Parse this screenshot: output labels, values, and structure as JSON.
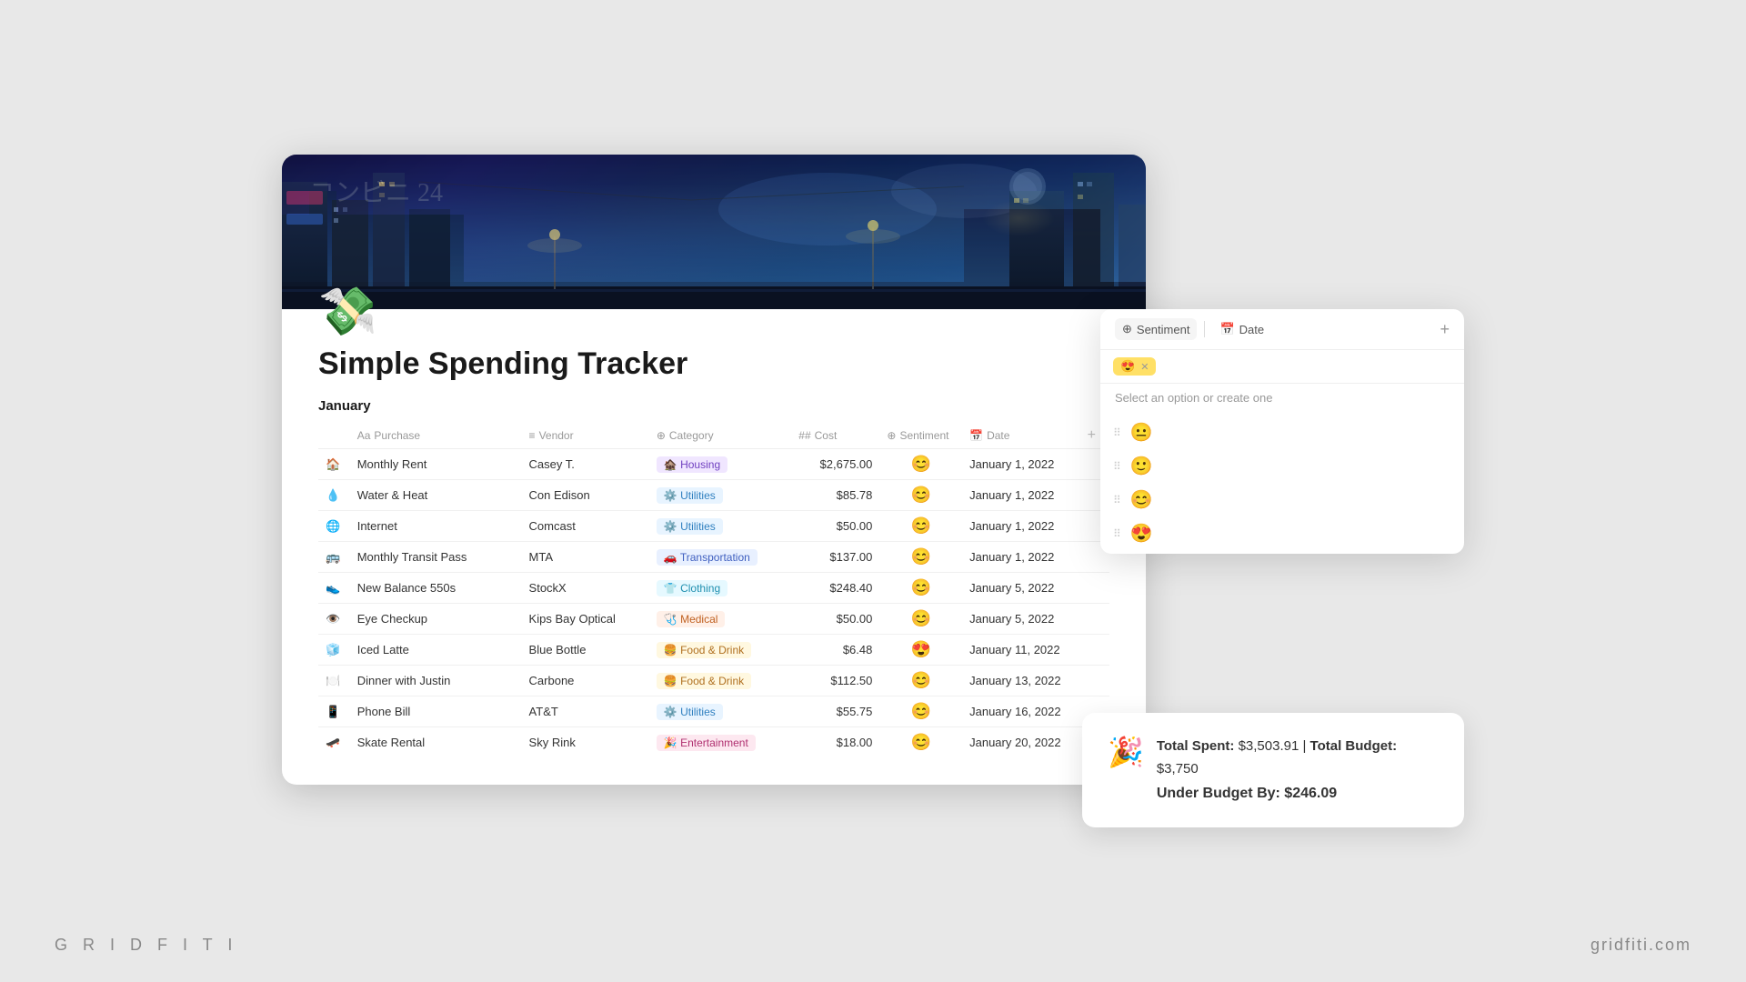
{
  "watermark": {
    "left": "G R I D F I T I",
    "right": "gridfiti.com"
  },
  "page": {
    "title": "Simple Spending Tracker",
    "icon": "💸",
    "section": "January"
  },
  "table": {
    "headers": [
      "Purchase",
      "Vendor",
      "Category",
      "Cost",
      "Sentiment",
      "Date"
    ],
    "rows": [
      {
        "icon": "🏠",
        "purchase": "Monthly Rent",
        "vendor": "Casey T.",
        "category": "Housing",
        "category_badge": "badge-housing",
        "category_icon": "🏚️",
        "cost": "$2,675.00",
        "sentiment": "😊",
        "date": "January 1, 2022"
      },
      {
        "icon": "💧",
        "purchase": "Water & Heat",
        "vendor": "Con Edison",
        "category": "Utilities",
        "category_badge": "badge-utilities",
        "category_icon": "⚙️",
        "cost": "$85.78",
        "sentiment": "😊",
        "date": "January 1, 2022"
      },
      {
        "icon": "🌐",
        "purchase": "Internet",
        "vendor": "Comcast",
        "category": "Utilities",
        "category_badge": "badge-utilities",
        "category_icon": "⚙️",
        "cost": "$50.00",
        "sentiment": "😊",
        "date": "January 1, 2022"
      },
      {
        "icon": "🚌",
        "purchase": "Monthly Transit Pass",
        "vendor": "MTA",
        "category": "Transportation",
        "category_badge": "badge-transportation",
        "category_icon": "🚗",
        "cost": "$137.00",
        "sentiment": "😊",
        "date": "January 1, 2022"
      },
      {
        "icon": "👟",
        "purchase": "New Balance 550s",
        "vendor": "StockX",
        "category": "Clothing",
        "category_badge": "badge-clothing",
        "category_icon": "👕",
        "cost": "$248.40",
        "sentiment": "😊",
        "date": "January 5, 2022"
      },
      {
        "icon": "👁️",
        "purchase": "Eye Checkup",
        "vendor": "Kips Bay Optical",
        "category": "Medical",
        "category_badge": "badge-medical",
        "category_icon": "🩺",
        "cost": "$50.00",
        "sentiment": "😊",
        "date": "January 5, 2022"
      },
      {
        "icon": "🧊",
        "purchase": "Iced Latte",
        "vendor": "Blue Bottle",
        "category": "Food & Drink",
        "category_badge": "badge-food",
        "category_icon": "🍔",
        "cost": "$6.48",
        "sentiment": "😍",
        "date": "January 11, 2022"
      },
      {
        "icon": "🍽️",
        "purchase": "Dinner with Justin",
        "vendor": "Carbone",
        "category": "Food & Drink",
        "category_badge": "badge-food",
        "category_icon": "🍔",
        "cost": "$112.50",
        "sentiment": "😊",
        "date": "January 13, 2022"
      },
      {
        "icon": "📱",
        "purchase": "Phone Bill",
        "vendor": "AT&T",
        "category": "Utilities",
        "category_badge": "badge-utilities",
        "category_icon": "⚙️",
        "cost": "$55.75",
        "sentiment": "😊",
        "date": "January 16, 2022"
      },
      {
        "icon": "🛹",
        "purchase": "Skate Rental",
        "vendor": "Sky Rink",
        "category": "Entertainment",
        "category_badge": "badge-entertainment",
        "category_icon": "🎉",
        "cost": "$18.00",
        "sentiment": "😊",
        "date": "January 20, 2022"
      }
    ]
  },
  "dropdown": {
    "sentiment_header": "Sentiment",
    "date_header": "Date",
    "add_label": "+",
    "current_tag": "😍",
    "search_placeholder": "",
    "hint": "Select an option or create one",
    "options": [
      "😐",
      "🙂",
      "😊",
      "😍"
    ]
  },
  "budget": {
    "emoji": "🎉",
    "total_spent_label": "Total Spent:",
    "total_spent_value": "$3,503.91",
    "separator": "|",
    "total_budget_label": "Total Budget:",
    "total_budget_value": "$3,750",
    "under_budget_label": "Under Budget By:",
    "under_budget_value": "$246.09"
  }
}
